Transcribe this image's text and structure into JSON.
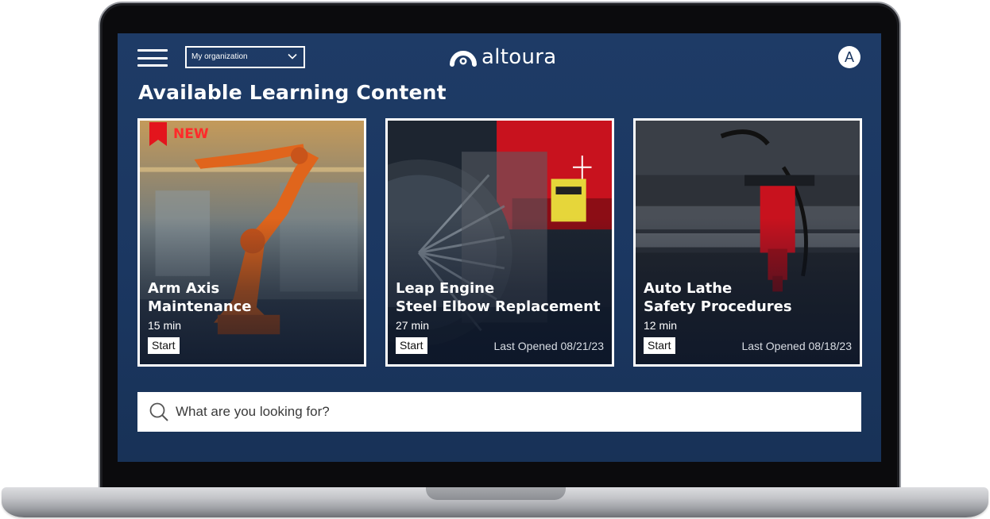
{
  "header": {
    "org_select": {
      "value": "My organization"
    },
    "logo_text": "altoura",
    "avatar_letter": "A"
  },
  "page_title": "Available Learning Content",
  "cards": [
    {
      "title": "Arm Axis\nMaintenance",
      "duration": "15 min",
      "start_label": "Start",
      "badge": "NEW",
      "last_opened": ""
    },
    {
      "title": "Leap Engine\nSteel Elbow Replacement",
      "duration": "27 min",
      "start_label": "Start",
      "last_opened": "Last Opened 08/21/23"
    },
    {
      "title": "Auto Lathe\nSafety Procedures",
      "duration": "12 min",
      "start_label": "Start",
      "last_opened": "Last Opened 08/18/23"
    }
  ],
  "search": {
    "placeholder": "What are you looking for?",
    "value": ""
  },
  "colors": {
    "screen_bg": "#1b3761",
    "badge_red": "#ff2a2a",
    "accent_red": "#c8121e",
    "robot_orange": "#e0651c"
  },
  "icons": [
    "menu-icon",
    "chevron-down-icon",
    "altoura-logo-icon",
    "bookmark-ribbon-icon",
    "search-icon"
  ]
}
